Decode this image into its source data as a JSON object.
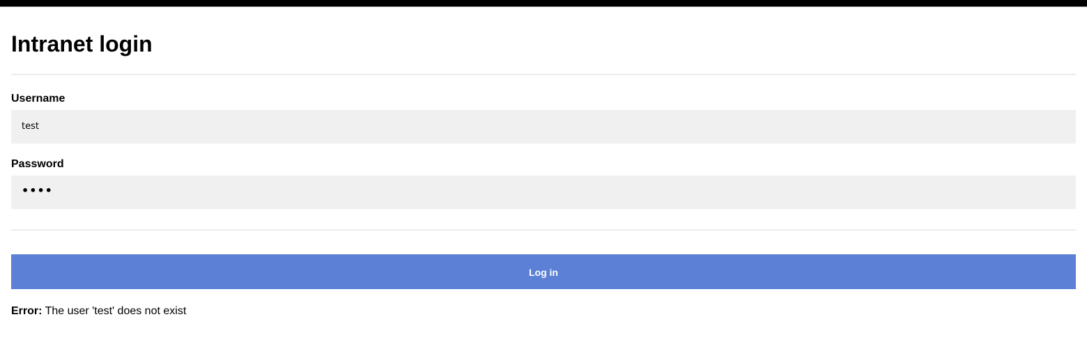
{
  "page": {
    "title": "Intranet login"
  },
  "form": {
    "username_label": "Username",
    "username_value": "test",
    "password_label": "Password",
    "password_value": "••••",
    "login_label": "Log in"
  },
  "error": {
    "prefix": "Error:",
    "message": " The user 'test' does not exist"
  },
  "colors": {
    "button": "#5b80d6",
    "input_background": "#f0f0f0",
    "top_bar": "#000000"
  }
}
